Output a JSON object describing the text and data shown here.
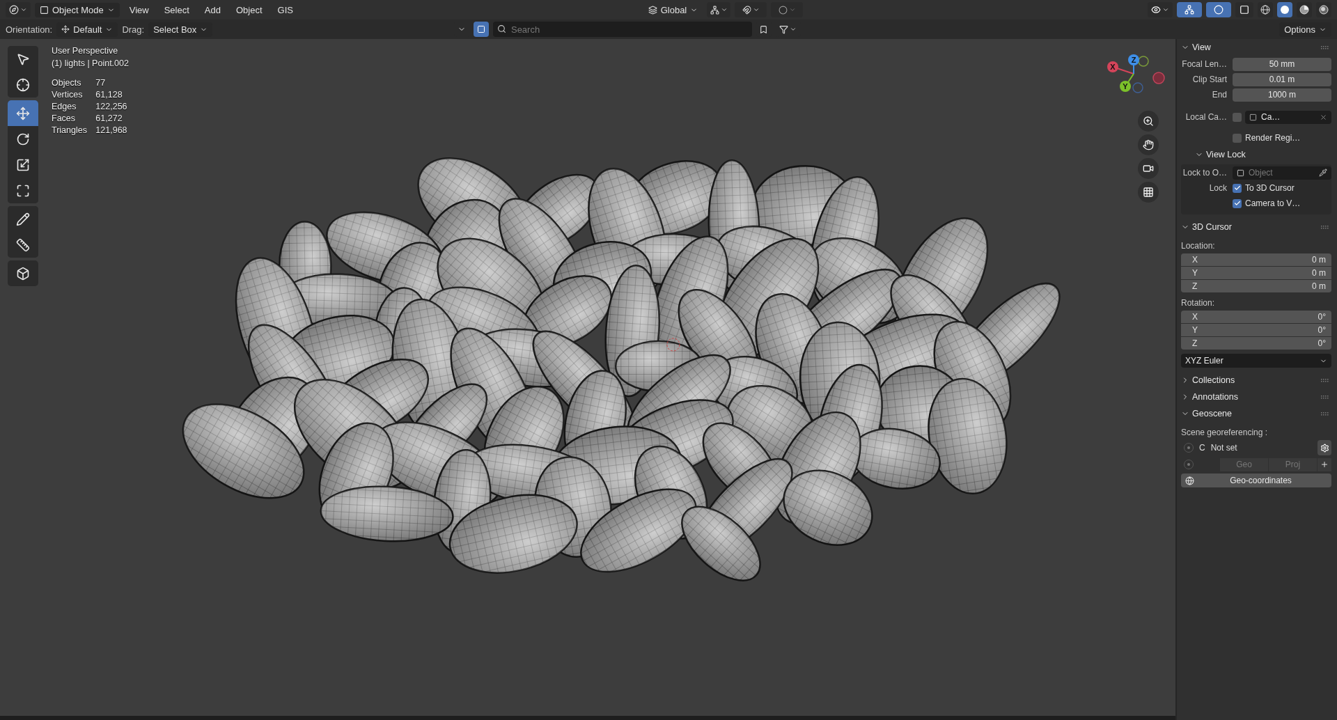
{
  "header": {
    "toggles": [
      {
        "kind": "gizmo",
        "on": true
      },
      {
        "kind": "overlay",
        "on": true
      },
      {
        "kind": "xray",
        "on": false
      }
    ],
    "mode": "Object Mode",
    "menus": [
      "View",
      "Select",
      "Add",
      "Object",
      "GIS"
    ],
    "orientation": "Global",
    "shading": [
      {
        "kind": "wireframe",
        "selected": false
      },
      {
        "kind": "solid",
        "selected": true
      },
      {
        "kind": "material",
        "selected": false
      },
      {
        "kind": "rendered",
        "selected": false
      }
    ]
  },
  "tool_settings": {
    "object_filter": {
      "on": true
    },
    "orientation_label": "Orientation:",
    "orientation": "Default",
    "drag_label": "Drag:",
    "drag": "Select Box",
    "search": {
      "placeholder": "Search"
    },
    "options": "Options"
  },
  "viewport": {
    "title": "User Perspective",
    "context": "(1) lights | Point.002",
    "stats": [
      {
        "label": "Objects",
        "value": "77"
      },
      {
        "label": "Vertices",
        "value": "61,128"
      },
      {
        "label": "Edges",
        "value": "122,256"
      },
      {
        "label": "Faces",
        "value": "61,272"
      },
      {
        "label": "Triangles",
        "value": "121,968"
      }
    ],
    "tools": [
      {
        "kind": "select",
        "selected": false
      },
      {
        "kind": "cursor",
        "selected": false
      },
      {
        "kind": "move",
        "selected": true
      },
      {
        "kind": "rotate",
        "selected": false
      },
      {
        "kind": "scale",
        "selected": false
      },
      {
        "kind": "transform",
        "selected": false
      },
      {
        "kind": "annotate",
        "selected": false
      },
      {
        "kind": "measure",
        "selected": false
      },
      {
        "kind": "add_cube",
        "selected": false
      }
    ],
    "gizmo": [
      "X",
      "Y",
      "Z"
    ]
  },
  "sidebar": {
    "view": {
      "title": "View",
      "expanded": true,
      "fields": [
        {
          "label": "Focal Len…",
          "value": "50 mm"
        },
        {
          "label": "Clip Start",
          "value": "0.01 m"
        },
        {
          "label": "End",
          "value": "1000 m"
        }
      ],
      "local_camera": {
        "label": "Local Ca…",
        "checked": false,
        "value": "Ca…"
      },
      "render_region": {
        "label": "Render Regi…",
        "checked": false
      },
      "view_lock": {
        "title": "View Lock",
        "expanded": true,
        "lock_to_label": "Lock to O…",
        "lock_to_placeholder": "Object",
        "lock_label": "Lock",
        "options": [
          {
            "label": "To 3D Cursor",
            "checked": true
          },
          {
            "label": "Camera to V…",
            "checked": true
          }
        ]
      }
    },
    "cursor": {
      "title": "3D Cursor",
      "expanded": true,
      "location_label": "Location:",
      "location": [
        {
          "axis": "X",
          "value": "0 m"
        },
        {
          "axis": "Y",
          "value": "0 m"
        },
        {
          "axis": "Z",
          "value": "0 m"
        }
      ],
      "rotation_label": "Rotation:",
      "rotation": [
        {
          "axis": "X",
          "value": "0°"
        },
        {
          "axis": "Y",
          "value": "0°"
        },
        {
          "axis": "Z",
          "value": "0°"
        }
      ],
      "rotation_mode": "XYZ Euler"
    },
    "collapsed": [
      {
        "title": "Collections",
        "expanded": false
      },
      {
        "title": "Annotations",
        "expanded": false
      }
    ],
    "geoscene": {
      "title": "Geoscene",
      "expanded": true,
      "label": "Scene georeferencing :",
      "radios": [
        {
          "selected": false
        },
        {
          "selected": false
        }
      ],
      "crs_code": "C",
      "crs_status": "Not set",
      "geo": "Geo",
      "proj": "Proj",
      "button": "Geo-coordinates"
    }
  }
}
